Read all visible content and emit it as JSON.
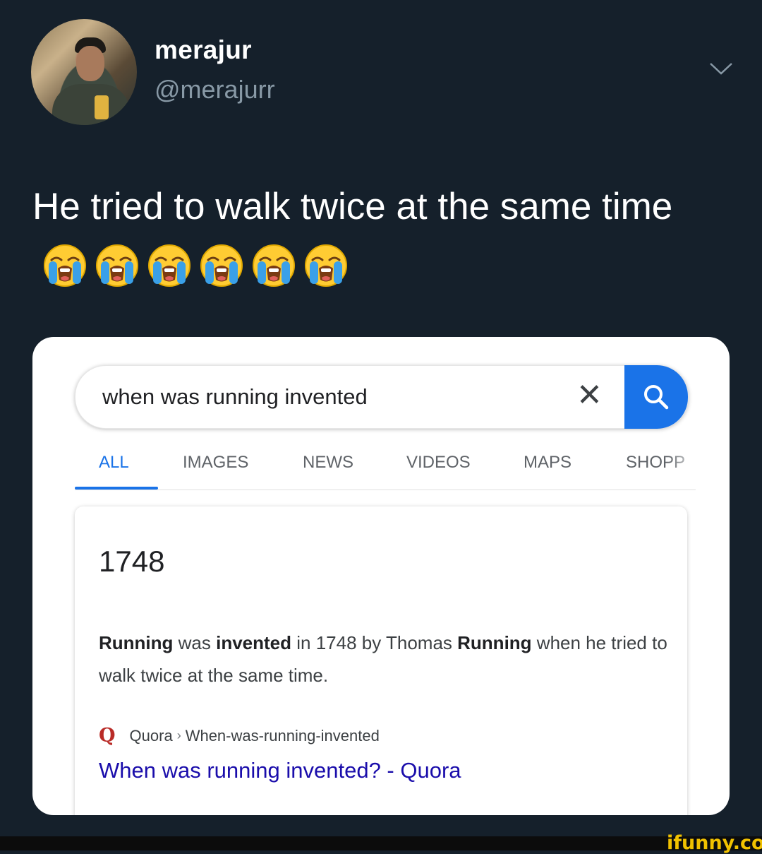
{
  "tweet": {
    "display_name": "merajur",
    "handle": "@merajurr",
    "text": "He tried to walk twice at the same time",
    "emojis": [
      "loudly-crying-face-icon",
      "loudly-crying-face-icon",
      "loudly-crying-face-icon",
      "loudly-crying-face-icon",
      "loudly-crying-face-icon",
      "loudly-crying-face-icon"
    ]
  },
  "search": {
    "query": "when was running invented",
    "clear_symbol": "✕",
    "tabs": [
      "ALL",
      "IMAGES",
      "NEWS",
      "VIDEOS",
      "MAPS",
      "SHOPP"
    ],
    "active_tab": "ALL",
    "accent_color": "#1a73e8"
  },
  "result": {
    "answer": "1748",
    "snippet_parts": [
      {
        "text": "Running",
        "bold": true
      },
      {
        "text": " was ",
        "bold": false
      },
      {
        "text": "invented",
        "bold": true
      },
      {
        "text": " in 1748 by Thomas ",
        "bold": false
      },
      {
        "text": "Running",
        "bold": true
      },
      {
        "text": " when he tried to walk twice at the same time.",
        "bold": false
      }
    ],
    "source_logo": "Q",
    "source_site": "Quora",
    "source_path": "When-was-running-invented",
    "link_title": "When was running invented? - Quora"
  },
  "watermark": "ifunny.co",
  "colors": {
    "background": "#15202b",
    "link": "#1a0dab",
    "quora": "#b92b27",
    "watermark": "#f2c200"
  }
}
